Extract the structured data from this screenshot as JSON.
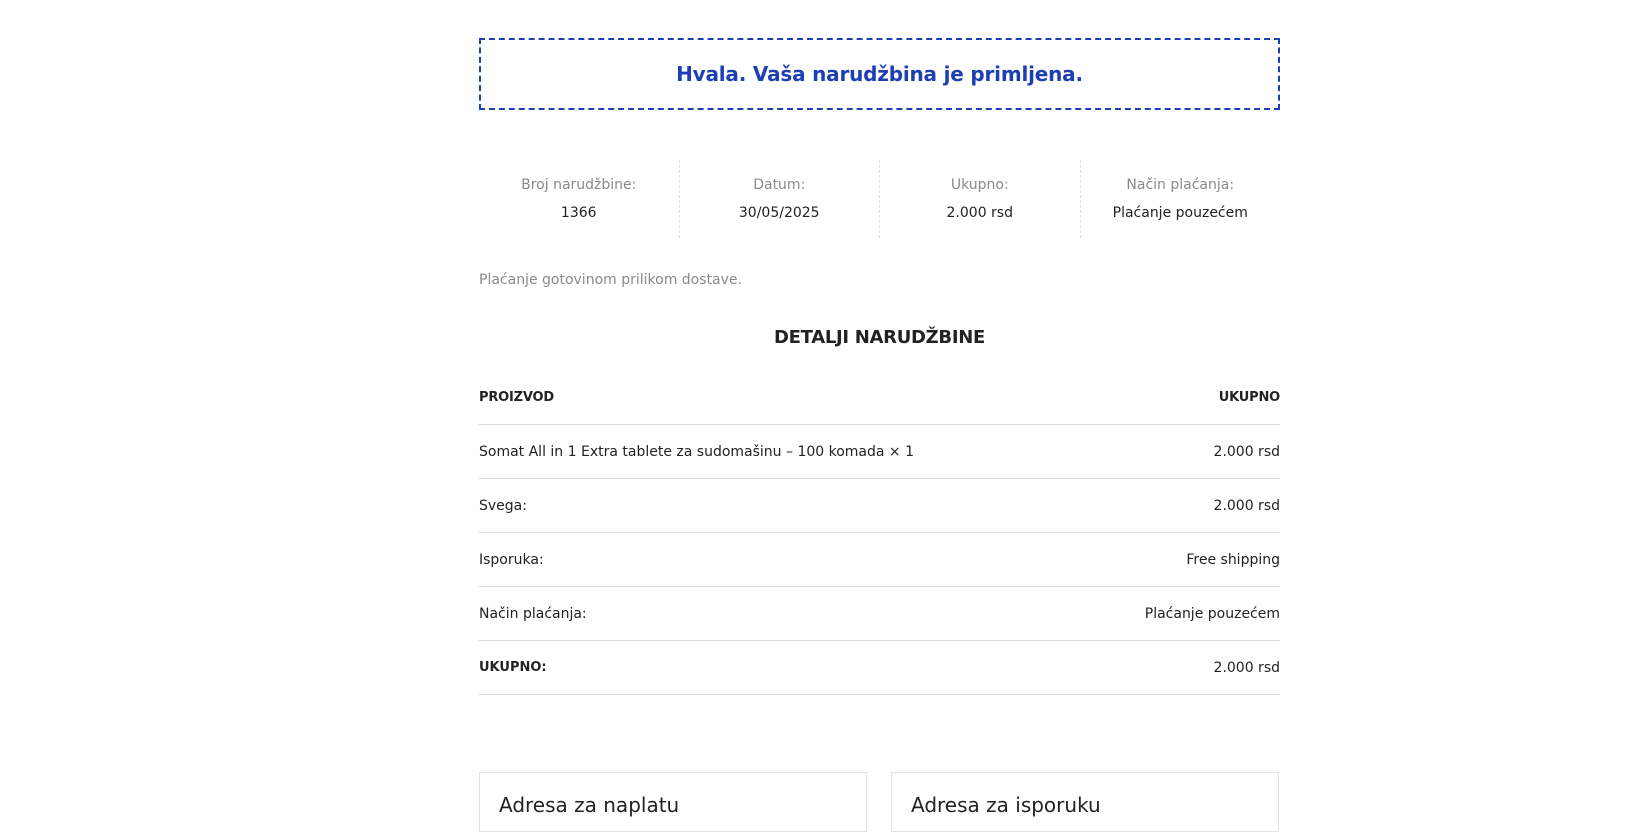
{
  "notice": {
    "text": "Hvala. Vaša narudžbina je primljena."
  },
  "overview": [
    {
      "label": "Broj narudžbine:",
      "value": "1366"
    },
    {
      "label": "Datum:",
      "value": "30/05/2025"
    },
    {
      "label": "Ukupno:",
      "value": "2.000 rsd"
    },
    {
      "label": "Način plaćanja:",
      "value": "Plaćanje pouzećem"
    }
  ],
  "payment_note": "Plaćanje gotovinom prilikom dostave.",
  "details": {
    "title": "DETALJI NARUDŽBINE",
    "header": {
      "product": "PROIZVOD",
      "total": "UKUPNO"
    },
    "rows": [
      {
        "label": "Somat All in 1 Extra tablete za sudomašinu – 100 komada × 1",
        "value": "2.000 rsd"
      },
      {
        "label": "Svega:",
        "value": "2.000 rsd"
      },
      {
        "label": "Isporuka:",
        "value": "Free shipping"
      },
      {
        "label": "Način plaćanja:",
        "value": "Plaćanje pouzećem"
      },
      {
        "label": "UKUPNO:",
        "value": "2.000 rsd"
      }
    ]
  },
  "addresses": {
    "billing_title": "Adresa za naplatu",
    "shipping_title": "Adresa za isporuku"
  },
  "colors": {
    "accent": "#1d3fb3",
    "muted": "#8a8a8a",
    "text": "#222222",
    "border": "#dddddd"
  }
}
